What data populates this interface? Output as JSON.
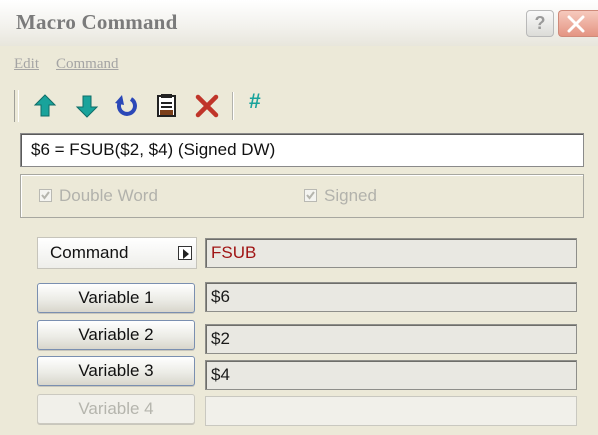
{
  "window": {
    "title": "Macro Command"
  },
  "menu": {
    "items": [
      "Edit",
      "Command"
    ]
  },
  "toolbar": {
    "buttons": [
      "move-up-icon",
      "move-down-icon",
      "undo-icon",
      "notes-icon",
      "delete-icon"
    ],
    "hash_label": "#"
  },
  "expression": "$6 = FSUB($2, $4) (Signed DW)",
  "options": {
    "double_word": {
      "label": "Double Word",
      "checked": true,
      "enabled": false
    },
    "signed": {
      "label": "Signed",
      "checked": true,
      "enabled": false
    }
  },
  "command": {
    "button_label": "Command",
    "value": "FSUB"
  },
  "variables": [
    {
      "label": "Variable 1",
      "value": "$6",
      "enabled": true
    },
    {
      "label": "Variable 2",
      "value": "$2",
      "enabled": true
    },
    {
      "label": "Variable 3",
      "value": "$4",
      "enabled": true
    },
    {
      "label": "Variable 4",
      "value": "",
      "enabled": false
    }
  ],
  "colors": {
    "command_value": "#a01414",
    "toolbar_icon": "#19a39b",
    "delete_icon": "#c0352a"
  }
}
